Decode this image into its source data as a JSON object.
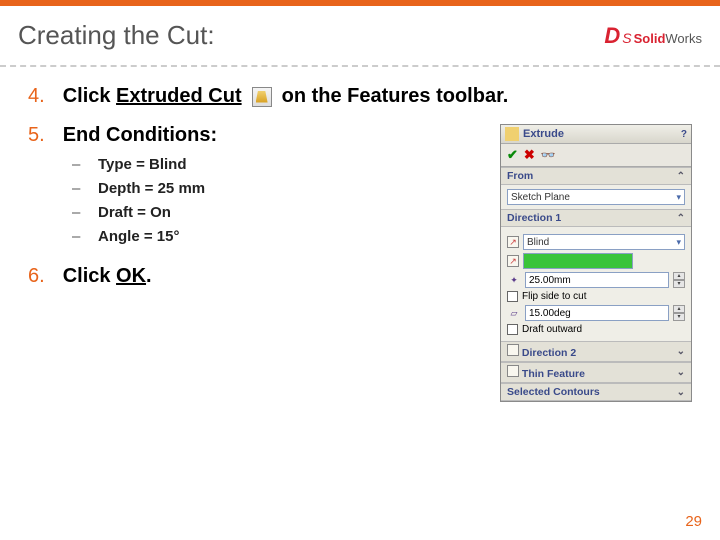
{
  "header": {
    "title": "Creating the Cut:",
    "logo_first": "Solid",
    "logo_second": "Works"
  },
  "steps": {
    "s4": {
      "num": "4.",
      "pre": "Click ",
      "link": "Extruded Cut",
      "post": " on the Features toolbar."
    },
    "s5": {
      "num": "5.",
      "title": "End Conditions:",
      "items": [
        {
          "dash": "–",
          "text": "Type = Blind"
        },
        {
          "dash": "–",
          "text": "Depth = 25 mm"
        },
        {
          "dash": "–",
          "text": "Draft = On"
        },
        {
          "dash": "–",
          "text": "Angle = 15°"
        }
      ]
    },
    "s6": {
      "num": "6.",
      "pre": "Click ",
      "link": "OK",
      "post": "."
    }
  },
  "panel": {
    "title": "Extrude",
    "help": "?",
    "from": {
      "header": "From",
      "value": "Sketch Plane"
    },
    "dir1": {
      "header": "Direction 1",
      "end_condition": "Blind",
      "depth": "25.00mm",
      "flip_label": "Flip side to cut",
      "angle": "15.00deg",
      "outward_label": "Draft outward"
    },
    "dir2": {
      "header": "Direction 2"
    },
    "thin": {
      "header": "Thin Feature"
    },
    "contours": {
      "header": "Selected Contours"
    }
  },
  "slide_number": "29"
}
